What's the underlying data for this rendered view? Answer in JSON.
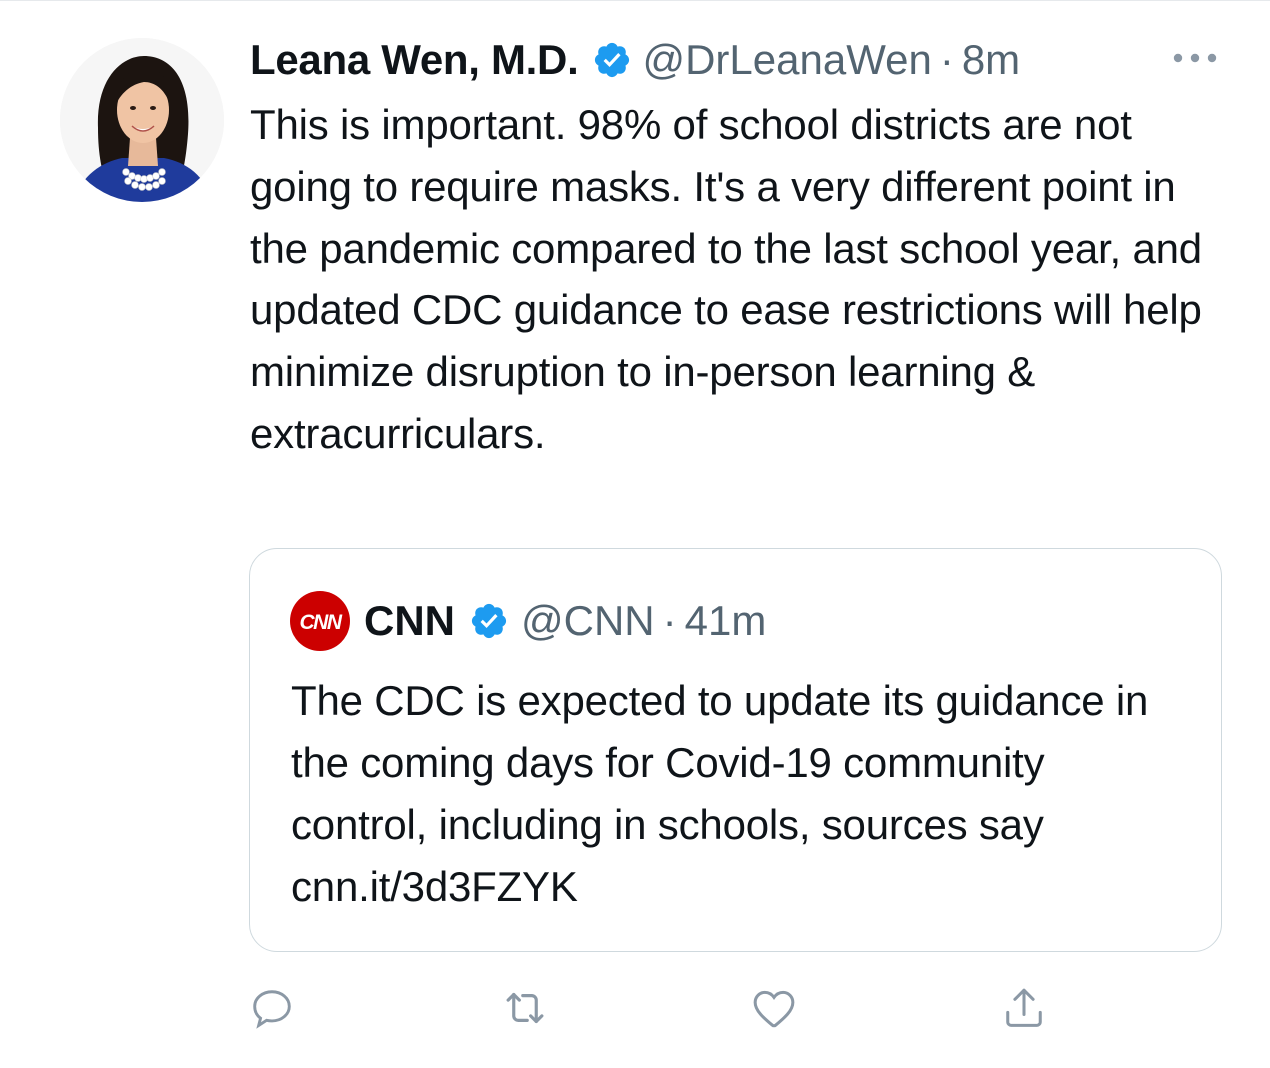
{
  "tweet": {
    "author_name": "Leana Wen, M.D.",
    "handle": "@DrLeanaWen",
    "separator": "·",
    "time": "8m",
    "text": "This is important. 98% of school districts are not going to require masks. It's a very different point in the pandemic compared to the last school year, and updated CDC guidance to ease restrictions will help minimize disruption to in-person learning & extracurriculars."
  },
  "quoted": {
    "author_name": "CNN",
    "handle": "@CNN",
    "separator": "·",
    "time": "41m",
    "text": "The CDC is expected to update its guidance in the coming days for Covid-19 community control, including in schools, sources say cnn.it/3d3FZYK",
    "logo_text": "CNN"
  },
  "icons": {
    "verified": "verified-badge-icon",
    "more": "more-options-icon",
    "reply": "reply-icon",
    "retweet": "retweet-icon",
    "like": "like-icon",
    "share": "share-icon"
  },
  "colors": {
    "verified_blue": "#1d9bf0",
    "text_primary": "#0f1419",
    "text_secondary": "#536471",
    "border": "#cfd9de",
    "cnn_red": "#cc0000"
  }
}
